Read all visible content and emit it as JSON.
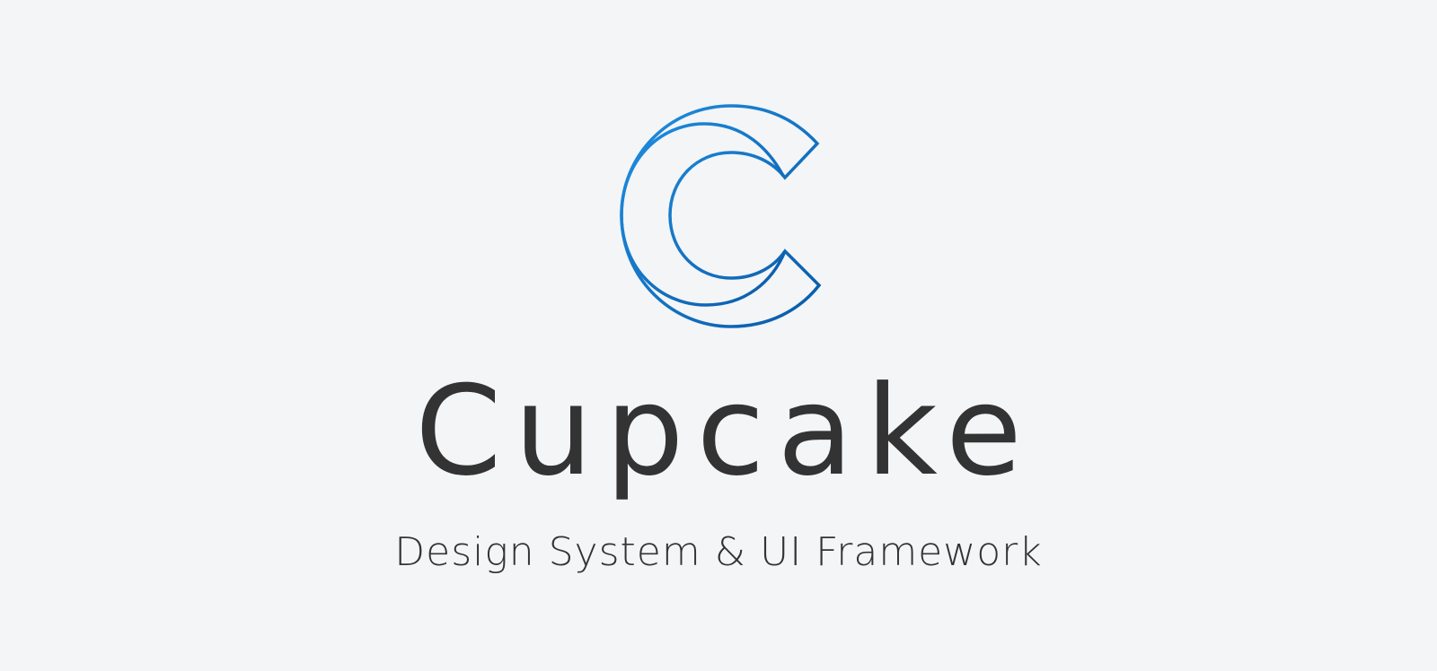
{
  "brand": {
    "name": "Cupcake",
    "tagline": "Design System & UI Framework",
    "logo_icon": "cupcake-c-logo-icon",
    "colors": {
      "background": "#f3f5f7",
      "logo_stroke_primary": "#1a7fd6",
      "logo_stroke_secondary": "#0a5aa8",
      "text": "#333333"
    }
  }
}
